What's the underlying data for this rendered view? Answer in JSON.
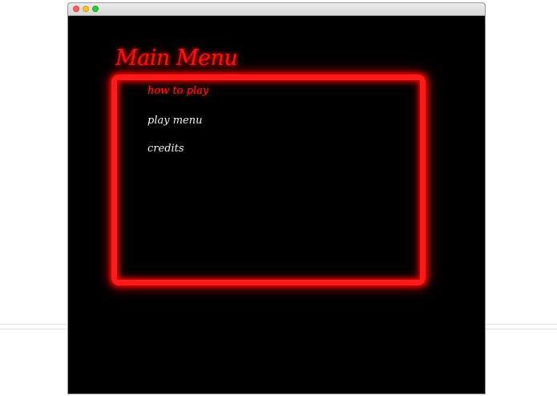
{
  "window": {
    "controls": [
      "close",
      "minimize",
      "zoom"
    ]
  },
  "game": {
    "title": "Main Menu",
    "accent_color": "#ff1a1a",
    "menu_items": [
      {
        "label": "how to play",
        "selected": true
      },
      {
        "label": "play menu",
        "selected": false
      },
      {
        "label": "credits",
        "selected": false
      }
    ]
  }
}
